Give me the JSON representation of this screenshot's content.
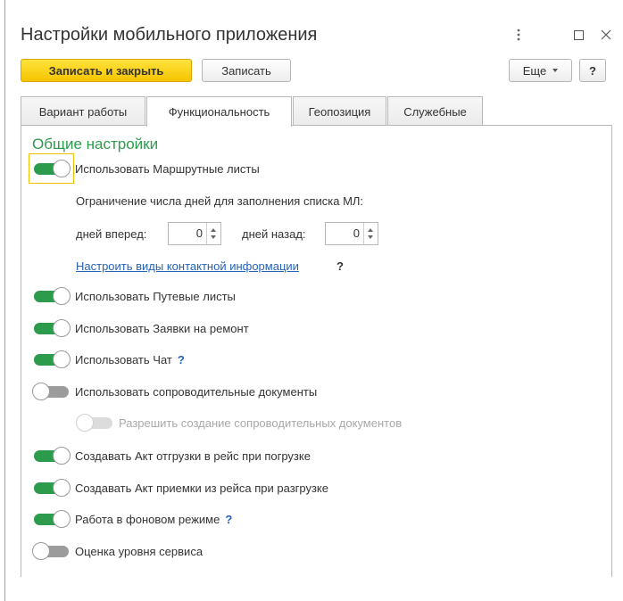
{
  "window": {
    "title": "Настройки мобильного приложения",
    "more_icon": "vertical-dots-icon",
    "maximize_icon": "maximize-icon",
    "close_icon": "close-icon"
  },
  "toolbar": {
    "save_close_label": "Записать и закрыть",
    "save_label": "Записать",
    "more_label": "Еще",
    "help_label": "?"
  },
  "tabs": [
    {
      "label": "Вариант работы",
      "active": false
    },
    {
      "label": "Функциональность",
      "active": true
    },
    {
      "label": "Геопозиция",
      "active": false
    },
    {
      "label": "Служебные",
      "active": false
    }
  ],
  "section": {
    "title": "Общие настройки"
  },
  "settings": {
    "route_sheets": {
      "label": "Использовать Маршрутные листы",
      "on": true
    },
    "limit_text": "Ограничение числа дней для заполнения списка МЛ:",
    "days_forward_label": "дней вперед:",
    "days_forward_value": "0",
    "days_back_label": "дней назад:",
    "days_back_value": "0",
    "contact_link": "Настроить виды контактной информации",
    "help_mark": "?",
    "waybills": {
      "label": "Использовать Путевые листы",
      "on": true
    },
    "repair_requests": {
      "label": "Использовать Заявки на ремонт",
      "on": true
    },
    "chat": {
      "label": "Использовать Чат",
      "on": true
    },
    "accompanying_docs": {
      "label": "Использовать сопроводительные документы",
      "on": false
    },
    "allow_accompanying": {
      "label": "Разрешить создание сопроводительных документов",
      "on": false,
      "disabled": true
    },
    "shipment_act": {
      "label": "Создавать Акт отгрузки в рейс при погрузке",
      "on": true
    },
    "acceptance_act": {
      "label": "Создавать Акт приемки из рейса при разгрузке",
      "on": true
    },
    "background_mode": {
      "label": "Работа в фоновом режиме",
      "on": true
    },
    "service_rating": {
      "label": "Оценка уровня сервиса",
      "on": false
    }
  },
  "colors": {
    "accent_green": "#2d9b4c",
    "primary_yellow": "#f5c400",
    "link_blue": "#2563b8"
  }
}
